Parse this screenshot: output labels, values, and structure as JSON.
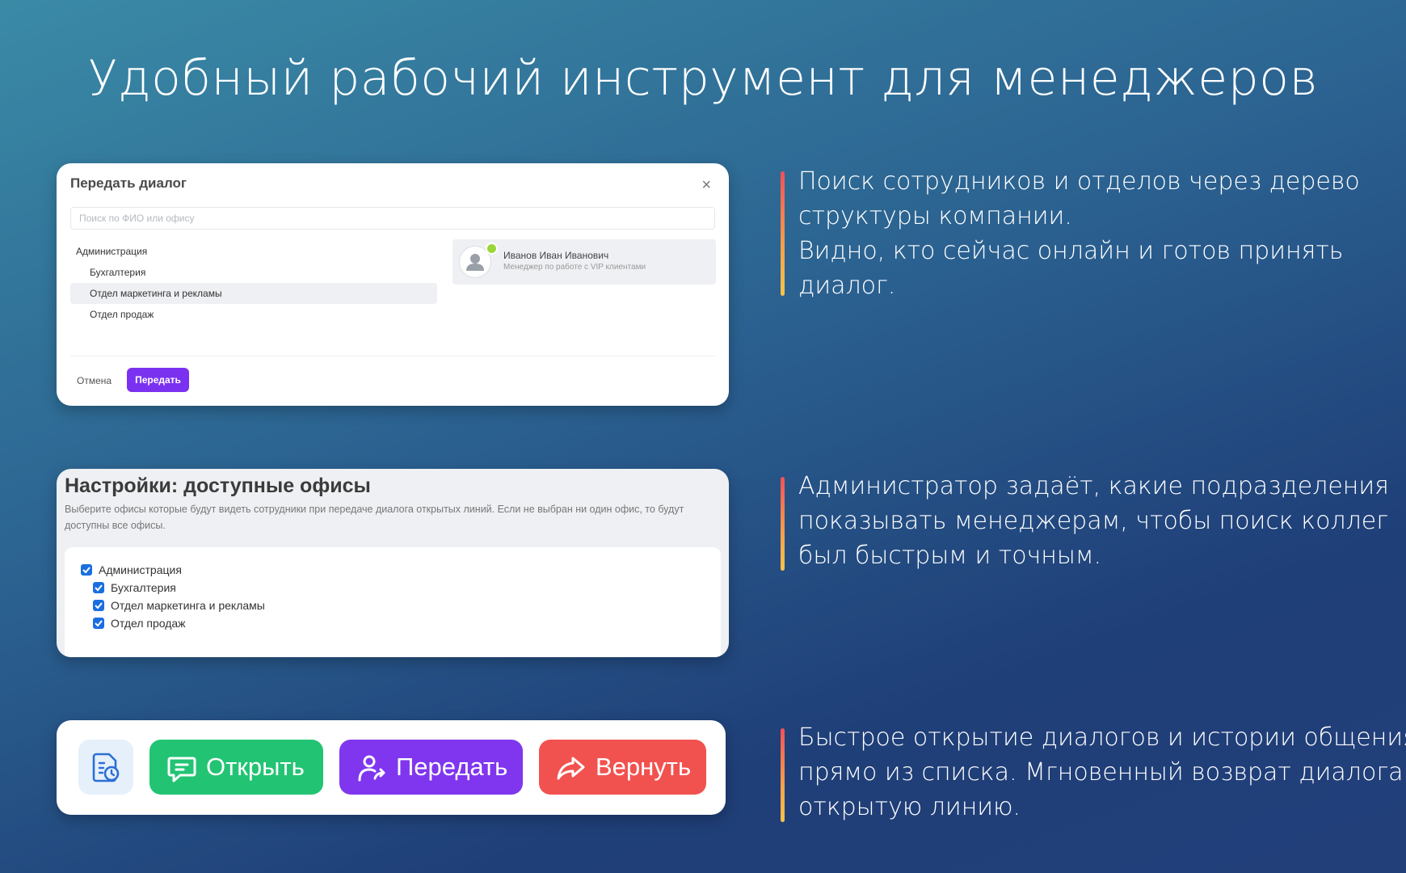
{
  "headline": "Удобный рабочий инструмент для менеджеров",
  "transfer_dialog": {
    "title": "Передать диалог",
    "close_glyph": "×",
    "search_placeholder": "Поиск по ФИО или офису",
    "tree": [
      {
        "label": "Администрация",
        "level": 0,
        "selected": false
      },
      {
        "label": "Бухгалтерия",
        "level": 1,
        "selected": false
      },
      {
        "label": "Отдел маркетинга и рекламы",
        "level": 1,
        "selected": true
      },
      {
        "label": "Отдел продаж",
        "level": 1,
        "selected": false
      }
    ],
    "employee": {
      "name": "Иванов Иван Иванович",
      "role": "Менеджер по работе с VIP клиентами",
      "online": true
    },
    "cancel_label": "Отмена",
    "submit_label": "Передать"
  },
  "settings": {
    "title": "Настройки: доступные офисы",
    "description": "Выберите офисы которые будут видеть сотрудники при передаче диалога открытых линий. Если не выбран ни один офис, то будут доступны все офисы.",
    "offices": [
      {
        "label": "Администрация",
        "level": 0,
        "checked": true
      },
      {
        "label": "Бухгалтерия",
        "level": 1,
        "checked": true
      },
      {
        "label": "Отдел маркетинга и рекламы",
        "level": 1,
        "checked": true
      },
      {
        "label": "Отдел продаж",
        "level": 1,
        "checked": true
      }
    ]
  },
  "actions": {
    "history_icon": "document-clock-icon",
    "open_label": "Открыть",
    "pass_label": "Передать",
    "return_label": "Вернуть",
    "colors": {
      "open": "#22c473",
      "pass": "#8036ee",
      "return": "#f2524f"
    }
  },
  "descriptions": [
    {
      "lines": [
        "Поиск сотрудников и отделов через дерево",
        "структуры компании.",
        "Видно, кто сейчас онлайн и готов принять",
        "диалог."
      ]
    },
    {
      "lines": [
        "Администратор задаёт, какие подразделения",
        "показывать менеджерам, чтобы поиск коллег",
        "был быстрым и точным."
      ]
    },
    {
      "lines": [
        "Быстрое открытие диалогов и истории общения",
        "прямо из списка. Мгновенный возврат диалога в",
        "открытую линию."
      ]
    }
  ]
}
